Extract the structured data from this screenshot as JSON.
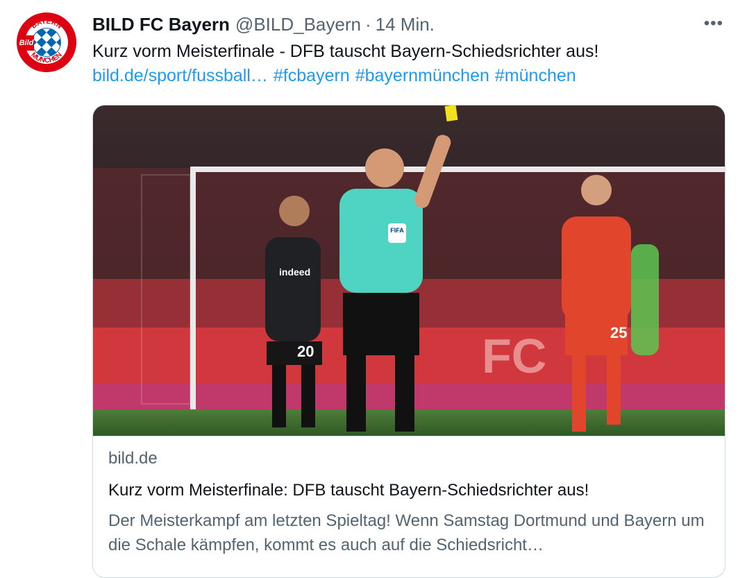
{
  "tweet": {
    "author_name": "BILD FC Bayern",
    "handle": "@BILD_Bayern",
    "separator": "·",
    "time": "14 Min.",
    "more_icon": "more-horizontal-icon",
    "text": "Kurz vorm Meisterfinale - DFB tauscht Bayern-Schiedsrichter aus!",
    "link": "bild.de/sport/fussball…",
    "hashtags": [
      "#fcbayern",
      "#bayernmünchen",
      "#münchen"
    ]
  },
  "avatar": {
    "ring_top_text": "BAYERN",
    "ring_bottom_text": "MÜNCHEN",
    "badge_text": "Bild"
  },
  "card": {
    "domain": "bild.de",
    "title": "Kurz vorm Meisterfinale: DFB tauscht Bayern-Schiedsrichter aus!",
    "description": "Der Meisterkampf am letzten Spieltag! Wenn Samstag Dortmund und Bayern um die Schale kämpfen, kommt es auch auf die Schiedsricht…",
    "image": {
      "sponsor_text": "indeed",
      "shirt_number_left": "20",
      "shirt_number_right": "25",
      "badge_text": "FIFA",
      "board_text": "FC"
    }
  },
  "colors": {
    "text": "#0f1419",
    "muted": "#536471",
    "link": "#1d9bf0",
    "border": "#cfd9de",
    "bild_red": "#dd0013"
  }
}
